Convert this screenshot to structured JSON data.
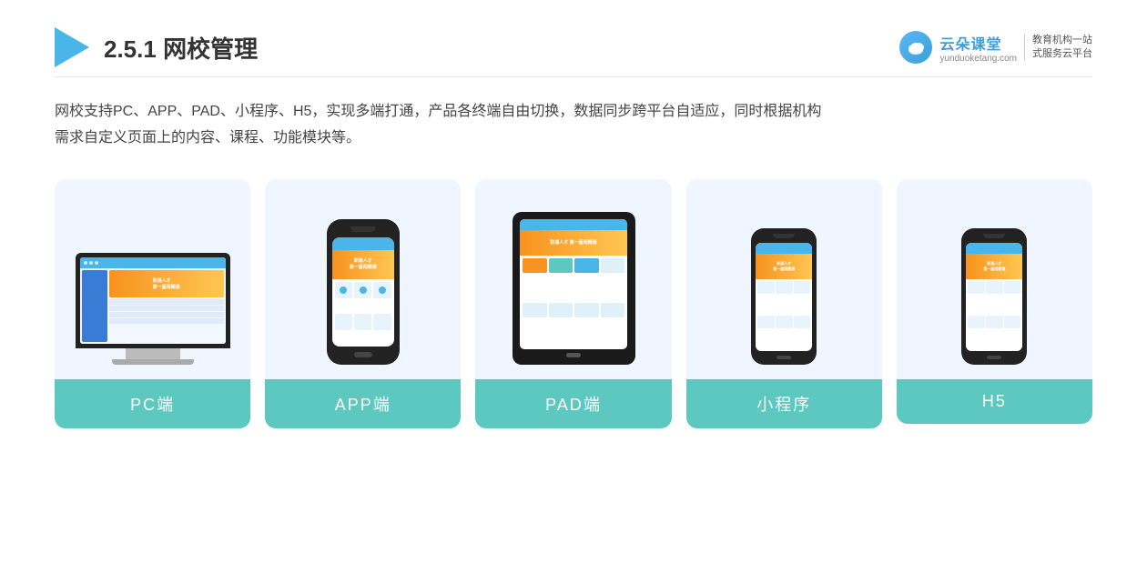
{
  "header": {
    "title_prefix": "2.5.1 ",
    "title_main": "网校管理",
    "logo": {
      "icon_label": "云朵",
      "brand_name": "云朵课堂",
      "brand_url": "yunduoketang.com",
      "slogan_line1": "教育机构一站",
      "slogan_line2": "式服务云平台"
    }
  },
  "description": {
    "line1": "网校支持PC、APP、PAD、小程序、H5，实现多端打通，产品各终端自由切换，数据同步跨平台自适应，同时根据机构",
    "line2": "需求自定义页面上的内容、课程、功能模块等。"
  },
  "cards": [
    {
      "id": "pc",
      "label": "PC端"
    },
    {
      "id": "app",
      "label": "APP端"
    },
    {
      "id": "pad",
      "label": "PAD端"
    },
    {
      "id": "mini",
      "label": "小程序"
    },
    {
      "id": "h5",
      "label": "H5"
    }
  ]
}
